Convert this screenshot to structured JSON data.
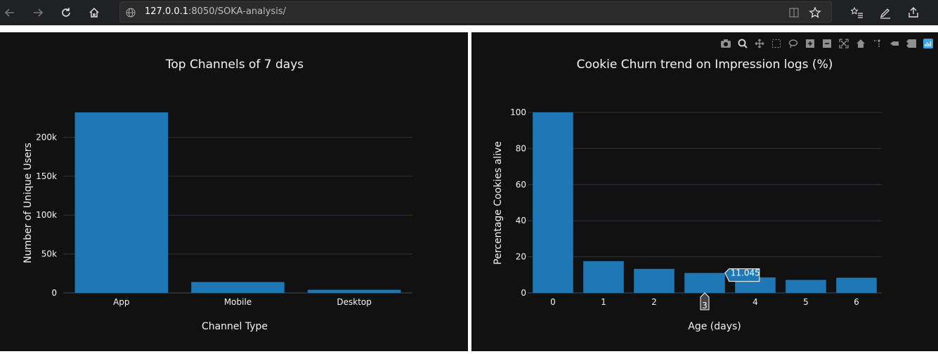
{
  "browser": {
    "url_host": "127.0.0.1",
    "url_rest": ":8050/SOKA-analysis/",
    "icons": {
      "back": "arrow-left-icon",
      "forward": "arrow-right-icon",
      "refresh": "refresh-icon",
      "home": "home-icon",
      "globe": "globe-icon",
      "reader": "reader-view-icon",
      "favorite": "star-icon",
      "favorites_list": "favorites-list-icon",
      "pen": "pen-icon",
      "share": "share-icon"
    }
  },
  "colors": {
    "bar": "#1f77b4",
    "panel_bg": "#111111",
    "text": "#f2f5fa",
    "grid": "#283442"
  },
  "modebar": {
    "buttons": [
      "camera-icon",
      "zoom-icon",
      "pan-icon",
      "box-select-icon",
      "lasso-icon",
      "zoom-in-icon",
      "zoom-out-icon",
      "autoscale-icon",
      "reset-axes-icon",
      "spike-lines-icon",
      "hover-closest-icon",
      "hover-compare-icon",
      "plotly-logo-icon"
    ]
  },
  "chart_data": [
    {
      "type": "bar",
      "title": "Top Channels of 7 days",
      "xlabel": "Channel Type",
      "ylabel": "Number of Unique Users",
      "categories": [
        "App",
        "Mobile",
        "Desktop"
      ],
      "values": [
        232000,
        14000,
        4000
      ],
      "ylim": [
        0,
        232000
      ],
      "yticks": [
        0,
        50000,
        100000,
        150000,
        200000
      ],
      "ytick_labels": [
        "0",
        "50k",
        "100k",
        "150k",
        "200k"
      ],
      "grid": true
    },
    {
      "type": "bar",
      "title": "Cookie Churn trend on Impression logs (%)",
      "xlabel": "Age (days)",
      "ylabel": "Percentage Cookies alive",
      "categories": [
        "0",
        "1",
        "2",
        "3",
        "4",
        "5",
        "6"
      ],
      "values": [
        100,
        17.6,
        13.3,
        11.045,
        8.6,
        7.2,
        8.4
      ],
      "ylim": [
        0,
        100
      ],
      "yticks": [
        0,
        20,
        40,
        60,
        80,
        100
      ],
      "ytick_labels": [
        "0",
        "20",
        "40",
        "60",
        "80",
        "100"
      ],
      "grid": true,
      "hover": {
        "index": 3,
        "value_label": "11.045",
        "x_label": "3"
      }
    }
  ]
}
